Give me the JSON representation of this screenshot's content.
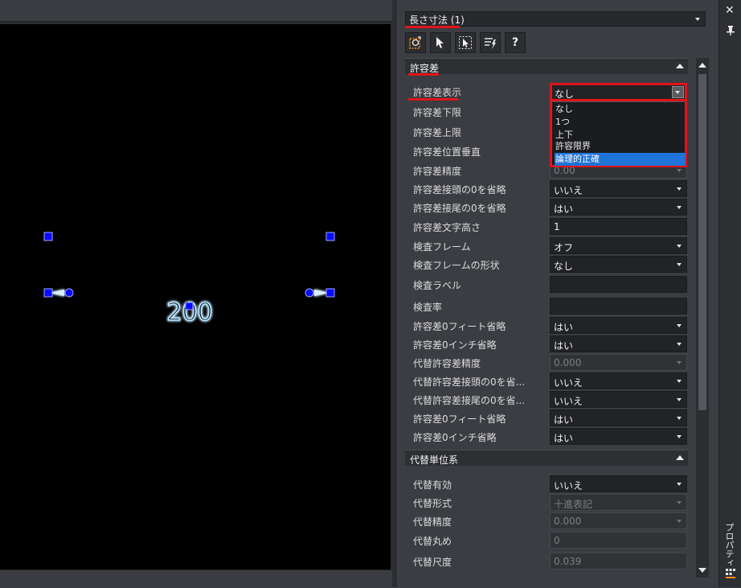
{
  "palette": {
    "object_selector": "長さ寸法 (1)",
    "title": "プロパティ",
    "toolbar": [
      {
        "icon": "quick-select-icon"
      },
      {
        "icon": "pickadd-icon"
      },
      {
        "icon": "select-objects-icon"
      },
      {
        "icon": "toggle-pickadd-icon"
      },
      {
        "icon": "help-icon",
        "label": "?"
      }
    ]
  },
  "drawing": {
    "dimension_text": "200"
  },
  "tolerance_section": {
    "title": "許容差",
    "rows": [
      {
        "label": "許容差表示",
        "value": "なし",
        "type": "dropdown-open"
      },
      {
        "label": "許容差下限",
        "value": "",
        "type": "hidden"
      },
      {
        "label": "許容差上限",
        "value": "",
        "type": "hidden"
      },
      {
        "label": "許容差位置垂直",
        "value": "",
        "type": "hidden"
      },
      {
        "label": "許容差精度",
        "value": "0.00",
        "type": "select-disabled"
      },
      {
        "label": "許容差接頭の0を省略",
        "value": "いいえ",
        "type": "select"
      },
      {
        "label": "許容差接尾の0を省略",
        "value": "はい",
        "type": "select"
      },
      {
        "label": "許容差文字高さ",
        "value": "1",
        "type": "text"
      },
      {
        "label": "検査フレーム",
        "value": "オフ",
        "type": "select"
      },
      {
        "label": "検査フレームの形状",
        "value": "なし",
        "type": "select"
      },
      {
        "label": "検査ラベル",
        "value": "",
        "type": "text"
      },
      {
        "label": "検査率",
        "value": "",
        "type": "text"
      },
      {
        "label": "許容差0フィート省略",
        "value": "はい",
        "type": "select"
      },
      {
        "label": "許容差0インチ省略",
        "value": "はい",
        "type": "select"
      },
      {
        "label": "代替許容差精度",
        "value": "0.000",
        "type": "select-disabled"
      },
      {
        "label": "代替許容差接頭の0を省...",
        "value": "いいえ",
        "type": "select"
      },
      {
        "label": "代替許容差接尾の0を省...",
        "value": "いいえ",
        "type": "select"
      },
      {
        "label": "許容差0フィート省略",
        "value": "はい",
        "type": "select"
      },
      {
        "label": "許容差0インチ省略",
        "value": "はい",
        "type": "select"
      }
    ],
    "dropdown_options": [
      "なし",
      "1つ",
      "上下",
      "許容限界",
      "論理的正確"
    ],
    "selected_option_index": 4
  },
  "alt_units_section": {
    "title": "代替単位系",
    "rows": [
      {
        "label": "代替有効",
        "value": "いいえ",
        "type": "select"
      },
      {
        "label": "代替形式",
        "value": "十進表記",
        "type": "select-disabled"
      },
      {
        "label": "代替精度",
        "value": "0.000",
        "type": "select-disabled"
      },
      {
        "label": "代替丸め",
        "value": "0",
        "type": "text-disabled"
      },
      {
        "label": "代替尺度",
        "value": "0.039",
        "type": "text-disabled"
      }
    ]
  },
  "colors": {
    "highlight_red": "#e0141b",
    "selected_blue": "#1f74d8",
    "dimension_glow": "#8fd0ff",
    "grip_blue": "#0a0aff"
  }
}
